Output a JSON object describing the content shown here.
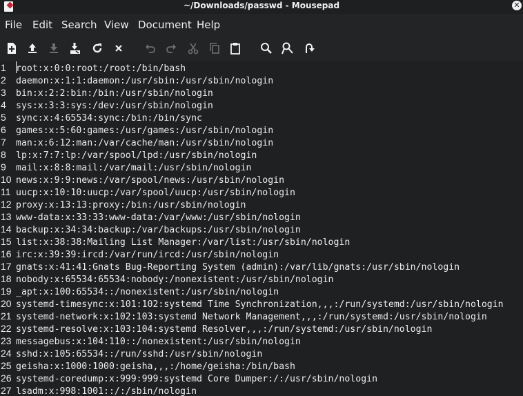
{
  "window": {
    "title": "~/Downloads/passwd - Mousepad"
  },
  "menu": [
    "File",
    "Edit",
    "Search",
    "View",
    "Document",
    "Help"
  ],
  "toolbar": {
    "new": "new-document-icon",
    "open": "open-file-icon",
    "save": "save-icon",
    "save_as": "save-as-icon",
    "reload": "reload-icon",
    "close": "close-icon",
    "undo": "undo-icon",
    "redo": "redo-icon",
    "cut": "cut-icon",
    "copy": "copy-icon",
    "paste": "paste-icon",
    "find": "find-icon",
    "replace": "find-replace-icon",
    "goto": "go-to-line-icon"
  },
  "lines": [
    {
      "n": "1",
      "t": "root:x:0:0:root:/root:/bin/bash"
    },
    {
      "n": "2",
      "t": "daemon:x:1:1:daemon:/usr/sbin:/usr/sbin/nologin"
    },
    {
      "n": "3",
      "t": "bin:x:2:2:bin:/bin:/usr/sbin/nologin"
    },
    {
      "n": "4",
      "t": "sys:x:3:3:sys:/dev:/usr/sbin/nologin"
    },
    {
      "n": "5",
      "t": "sync:x:4:65534:sync:/bin:/bin/sync"
    },
    {
      "n": "6",
      "t": "games:x:5:60:games:/usr/games:/usr/sbin/nologin"
    },
    {
      "n": "7",
      "t": "man:x:6:12:man:/var/cache/man:/usr/sbin/nologin"
    },
    {
      "n": "8",
      "t": "lp:x:7:7:lp:/var/spool/lpd:/usr/sbin/nologin"
    },
    {
      "n": "9",
      "t": "mail:x:8:8:mail:/var/mail:/usr/sbin/nologin"
    },
    {
      "n": "10",
      "t": "news:x:9:9:news:/var/spool/news:/usr/sbin/nologin"
    },
    {
      "n": "11",
      "t": "uucp:x:10:10:uucp:/var/spool/uucp:/usr/sbin/nologin"
    },
    {
      "n": "12",
      "t": "proxy:x:13:13:proxy:/bin:/usr/sbin/nologin"
    },
    {
      "n": "13",
      "t": "www-data:x:33:33:www-data:/var/www:/usr/sbin/nologin"
    },
    {
      "n": "14",
      "t": "backup:x:34:34:backup:/var/backups:/usr/sbin/nologin"
    },
    {
      "n": "15",
      "t": "list:x:38:38:Mailing List Manager:/var/list:/usr/sbin/nologin"
    },
    {
      "n": "16",
      "t": "irc:x:39:39:ircd:/var/run/ircd:/usr/sbin/nologin"
    },
    {
      "n": "17",
      "t": "gnats:x:41:41:Gnats Bug-Reporting System (admin):/var/lib/gnats:/usr/sbin/nologin"
    },
    {
      "n": "18",
      "t": "nobody:x:65534:65534:nobody:/nonexistent:/usr/sbin/nologin"
    },
    {
      "n": "19",
      "t": "_apt:x:100:65534::/nonexistent:/usr/sbin/nologin"
    },
    {
      "n": "20",
      "t": "systemd-timesync:x:101:102:systemd Time Synchronization,,,:/run/systemd:/usr/sbin/nologin"
    },
    {
      "n": "21",
      "t": "systemd-network:x:102:103:systemd Network Management,,,:/run/systemd:/usr/sbin/nologin"
    },
    {
      "n": "22",
      "t": "systemd-resolve:x:103:104:systemd Resolver,,,:/run/systemd:/usr/sbin/nologin"
    },
    {
      "n": "23",
      "t": "messagebus:x:104:110::/nonexistent:/usr/sbin/nologin"
    },
    {
      "n": "24",
      "t": "sshd:x:105:65534::/run/sshd:/usr/sbin/nologin"
    },
    {
      "n": "25",
      "t": "geisha:x:1000:1000:geisha,,,:/home/geisha:/bin/bash"
    },
    {
      "n": "26",
      "t": "systemd-coredump:x:999:999:systemd Core Dumper:/:/usr/sbin/nologin"
    },
    {
      "n": "27",
      "t": "lsadm:x:998:1001::/:/sbin/nologin"
    }
  ]
}
